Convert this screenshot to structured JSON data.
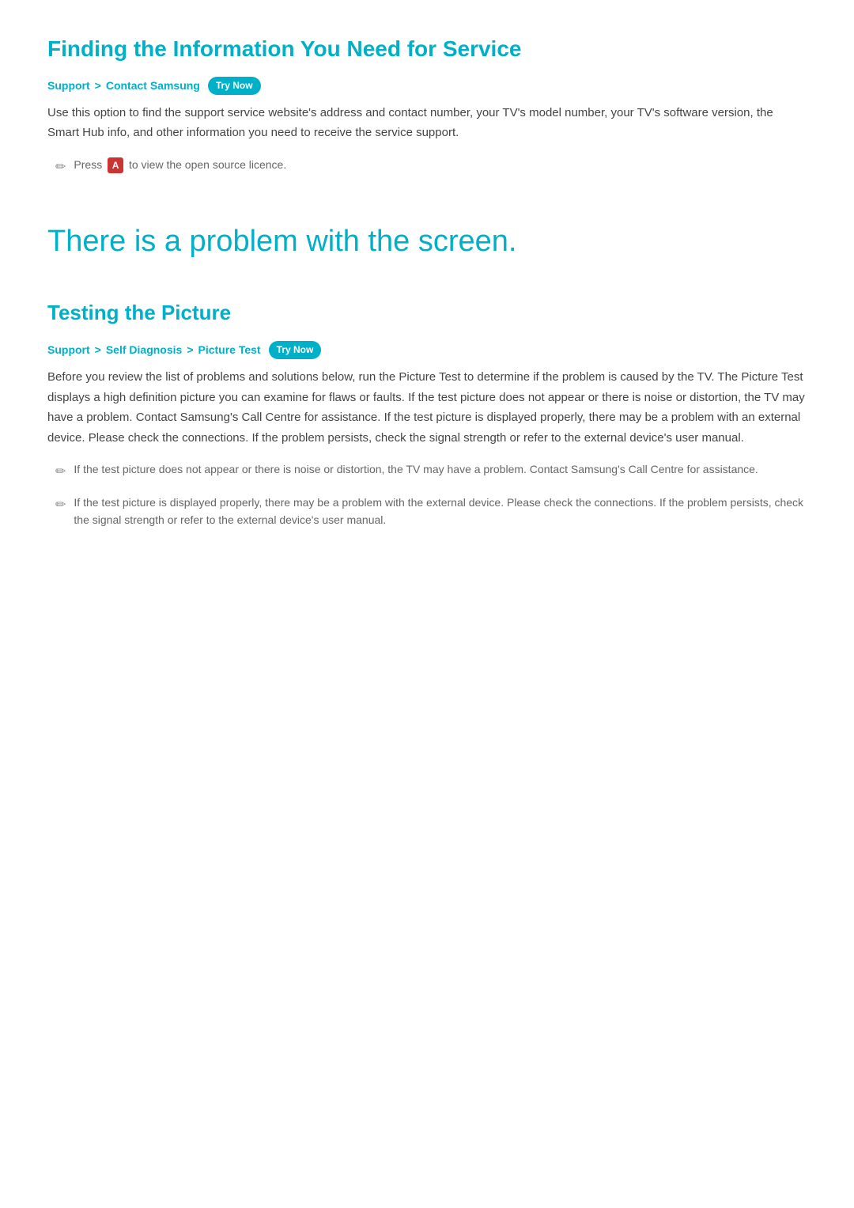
{
  "section1": {
    "title": "Finding the Information You Need for Service",
    "breadcrumb": {
      "part1": "Support",
      "separator1": ">",
      "part2": "Contact Samsung",
      "badge": "Try Now"
    },
    "body": "Use this option to find the support service website's address and contact number, your TV's model number, your TV's software version, the Smart Hub info, and other information you need to receive the service support.",
    "note": {
      "icon": "✏",
      "text_prefix": "Press",
      "key": "A",
      "text_suffix": "to view the open source licence."
    }
  },
  "section2": {
    "title": "There is a problem with the screen.",
    "subsection": {
      "title": "Testing the Picture",
      "breadcrumb": {
        "part1": "Support",
        "separator1": ">",
        "part2": "Self Diagnosis",
        "separator2": ">",
        "part3": "Picture Test",
        "badge": "Try Now"
      },
      "body": "Before you review the list of problems and solutions below, run the Picture Test to determine if the problem is caused by the TV. The Picture Test displays a high definition picture you can examine for flaws or faults. If the test picture does not appear or there is noise or distortion, the TV may have a problem. Contact Samsung's Call Centre for assistance. If the test picture is displayed properly, there may be a problem with an external device. Please check the connections. If the problem persists, check the signal strength or refer to the external device's user manual.",
      "notes": [
        {
          "icon": "✏",
          "text": "If the test picture does not appear or there is noise or distortion, the TV may have a problem. Contact Samsung's Call Centre for assistance."
        },
        {
          "icon": "✏",
          "text": "If the test picture is displayed properly, there may be a problem with the external device. Please check the connections. If the problem persists, check the signal strength or refer to the external device's user manual."
        }
      ]
    }
  }
}
